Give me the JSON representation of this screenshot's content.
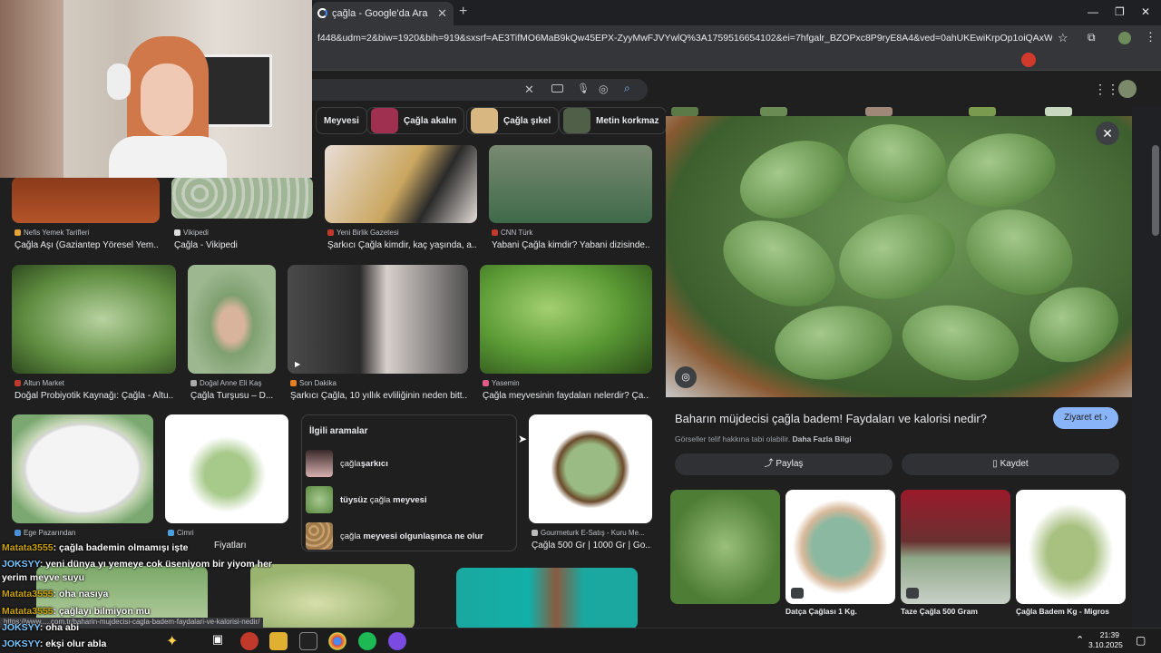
{
  "browser": {
    "tab_title": "çağla - Google'da Ara",
    "new_tab": "+",
    "url": "f448&udm=2&biw=1920&bih=919&sxsrf=AE3TifMO6MaB9kQw45EPX-ZyyMwFJVYwlQ%3A1759516654102&ei=7hfgalr_BZOPxc8P9ryE8A4&ved=0ahUKEwiKrpOp1oiQAxWTR_EDHXYeAe4Q4dU...",
    "minimize": "—",
    "restore": "❐",
    "close": "✕"
  },
  "chips": [
    {
      "label": "Meyvesi"
    },
    {
      "label": "Çağla akalın"
    },
    {
      "label": "Çağla şıkel"
    },
    {
      "label": "Metin korkmaz"
    }
  ],
  "results": [
    {
      "source": "Nefis Yemek Tarifleri",
      "title": "Çağla Aşı (Gaziantep Yöresel Yem..."
    },
    {
      "source": "Vikipedi",
      "title": "Çağla - Vikipedi"
    },
    {
      "source": "Yeni Birlik Gazetesi",
      "title": "Şarkıcı Çağla kimdir, kaç yaşında, a..."
    },
    {
      "source": "CNN Türk",
      "title": "Yabani Çağla kimdir? Yabani dizisinde..."
    },
    {
      "source": "Altun Market",
      "title": "Doğal Probiyotik Kaynağı: Çağla - Altu..."
    },
    {
      "source": "Doğal Anne Eli Kaş",
      "title": "Çağla Turşusu – D..."
    },
    {
      "source": "Son Dakika",
      "title": "Şarkıcı Çağla, 10 yıllık evliliğinin neden bitt..."
    },
    {
      "source": "Yasemin",
      "title": "Çağla meyvesinin faydaları nelerdir? Ça..."
    },
    {
      "source": "Ege Pazarından",
      "title": ""
    },
    {
      "source": "Cimri",
      "title": "Fiyatları"
    },
    {
      "source": "Gourmeturk E-Satış - Kuru Me...",
      "title": "Çağla 500 Gr | 1000 Gr | Go..."
    }
  ],
  "related": {
    "heading": "İlgili aramalar",
    "items": [
      {
        "pre": "çağla ",
        "bold": "şarkıcı",
        "post": ""
      },
      {
        "pre": "",
        "bold": "tüysüz",
        "post": " çağla "
      },
      {
        "pre": "çağla ",
        "bold": "meyvesi olgunlaşınca ne olur",
        "post": ""
      }
    ],
    "item2_bold2": "meyvesi"
  },
  "panel": {
    "title": "Baharın müjdecisi çağla badem! Faydaları ve kalorisi nedir?",
    "visit": "Ziyaret et ›",
    "copyright": "Görseller telif hakkına tabi olabilir.",
    "more_info": "Daha Fazla Bilgi",
    "share": "Paylaş",
    "save": "Kaydet",
    "close": "✕",
    "similar": [
      {
        "label": ""
      },
      {
        "label": "Datça Çağlası 1 Kg."
      },
      {
        "label": "Taze Çağla 500 Gram"
      },
      {
        "label": "Çağla Badem Kg - Migros"
      }
    ]
  },
  "chat": [
    {
      "user": "Matata3555",
      "msg": ": çağla bademin olmamışı işte"
    },
    {
      "user": "JOKSYY",
      "msg": ": yeni dünya yı yemeye cok üseniyom bir yiyom her"
    },
    {
      "user": "",
      "msg": "yerim meyve suyu"
    },
    {
      "user": "Matata3555",
      "msg": ": oha nasıya"
    },
    {
      "user": "Matata3555",
      "msg": ": çağlayı bilmiyon mu"
    },
    {
      "user": "JOKSYY",
      "msg": ": oha abi"
    },
    {
      "user": "JOKSYY",
      "msg": ": ekşi olur abla"
    }
  ],
  "status_url": "https://www.....com.tr/baharin-mujdecisi-cagla-badem-faydalari-ve-kalorisi-nedir/",
  "taskbar": {
    "time": "21:39",
    "date": "3.10.2025"
  }
}
